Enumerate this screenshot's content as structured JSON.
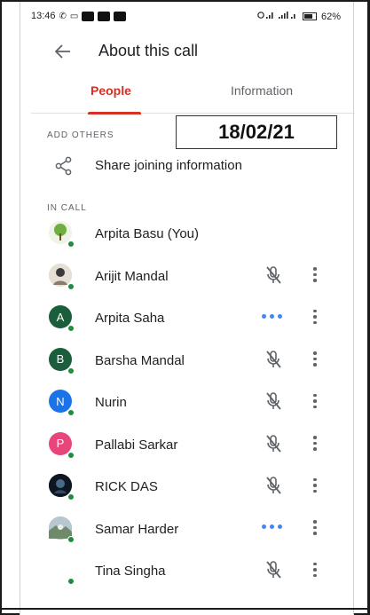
{
  "status_bar": {
    "time": "13:46",
    "battery": "62%",
    "signal_text": "0.ıl 㛲ıl"
  },
  "header": {
    "title": "About this call"
  },
  "tabs": [
    {
      "label": "People",
      "active": true
    },
    {
      "label": "Information",
      "active": false
    }
  ],
  "add_others": {
    "label": "ADD OTHERS",
    "share_label": "Share joining information"
  },
  "date_stamp": "18/02/21",
  "in_call": {
    "label": "IN CALL",
    "participants": [
      {
        "name": "Arpita Basu (You)",
        "avatar": "photo-tree",
        "status": "none"
      },
      {
        "name": "Arijit Mandal",
        "avatar": "photo",
        "status": "muted"
      },
      {
        "name": "Arpita Saha",
        "avatar": "letter",
        "letter": "A",
        "color": "#1b5e3b",
        "status": "speaking"
      },
      {
        "name": "Barsha Mandal",
        "avatar": "letter",
        "letter": "B",
        "color": "#1b5e3b",
        "status": "muted"
      },
      {
        "name": "Nurin",
        "avatar": "letter",
        "letter": "N",
        "color": "#1a73e8",
        "status": "muted"
      },
      {
        "name": "Pallabi Sarkar",
        "avatar": "letter",
        "letter": "P",
        "color": "#e8457a",
        "status": "muted"
      },
      {
        "name": "RICK DAS",
        "avatar": "photo-dark",
        "status": "muted"
      },
      {
        "name": "Samar Harder",
        "avatar": "photo-landscape",
        "status": "speaking"
      },
      {
        "name": "Tina Singha",
        "avatar": "none",
        "status": "muted"
      }
    ]
  },
  "colors": {
    "accent": "#d93025",
    "online": "#1e8e3e",
    "speaking": "#4285f4"
  }
}
